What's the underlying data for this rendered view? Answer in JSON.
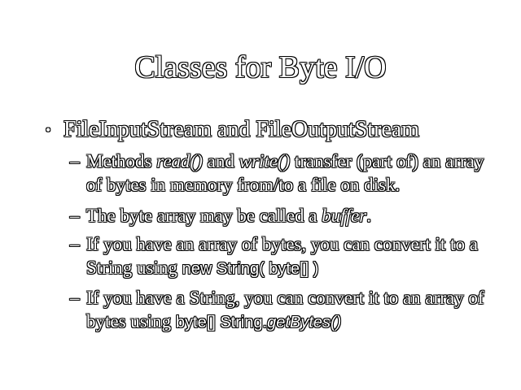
{
  "slide": {
    "title": "Classes for Byte I/O",
    "bullet": {
      "marker": "•",
      "text": "FileInputStream and FileOutputStream"
    },
    "subbullets": [
      {
        "dash": "–",
        "p1": "Methods ",
        "read": "read()",
        "p2": " and ",
        "write": "write()",
        "p3": " transfer (part of) an array of bytes in memory from/to a file on disk."
      },
      {
        "dash": "–",
        "p1": "The byte array may be called a ",
        "buffer": "buffer",
        "p2": "."
      },
      {
        "dash": "–",
        "p1": " If you have an array of bytes, you can convert it to a String using ",
        "code": "new String( byte[] )"
      },
      {
        "dash": "–",
        "p1": "If you have a String, you can convert it to an array of bytes using ",
        "code1": "byte[] String.",
        "code2": "getBytes()"
      }
    ]
  }
}
